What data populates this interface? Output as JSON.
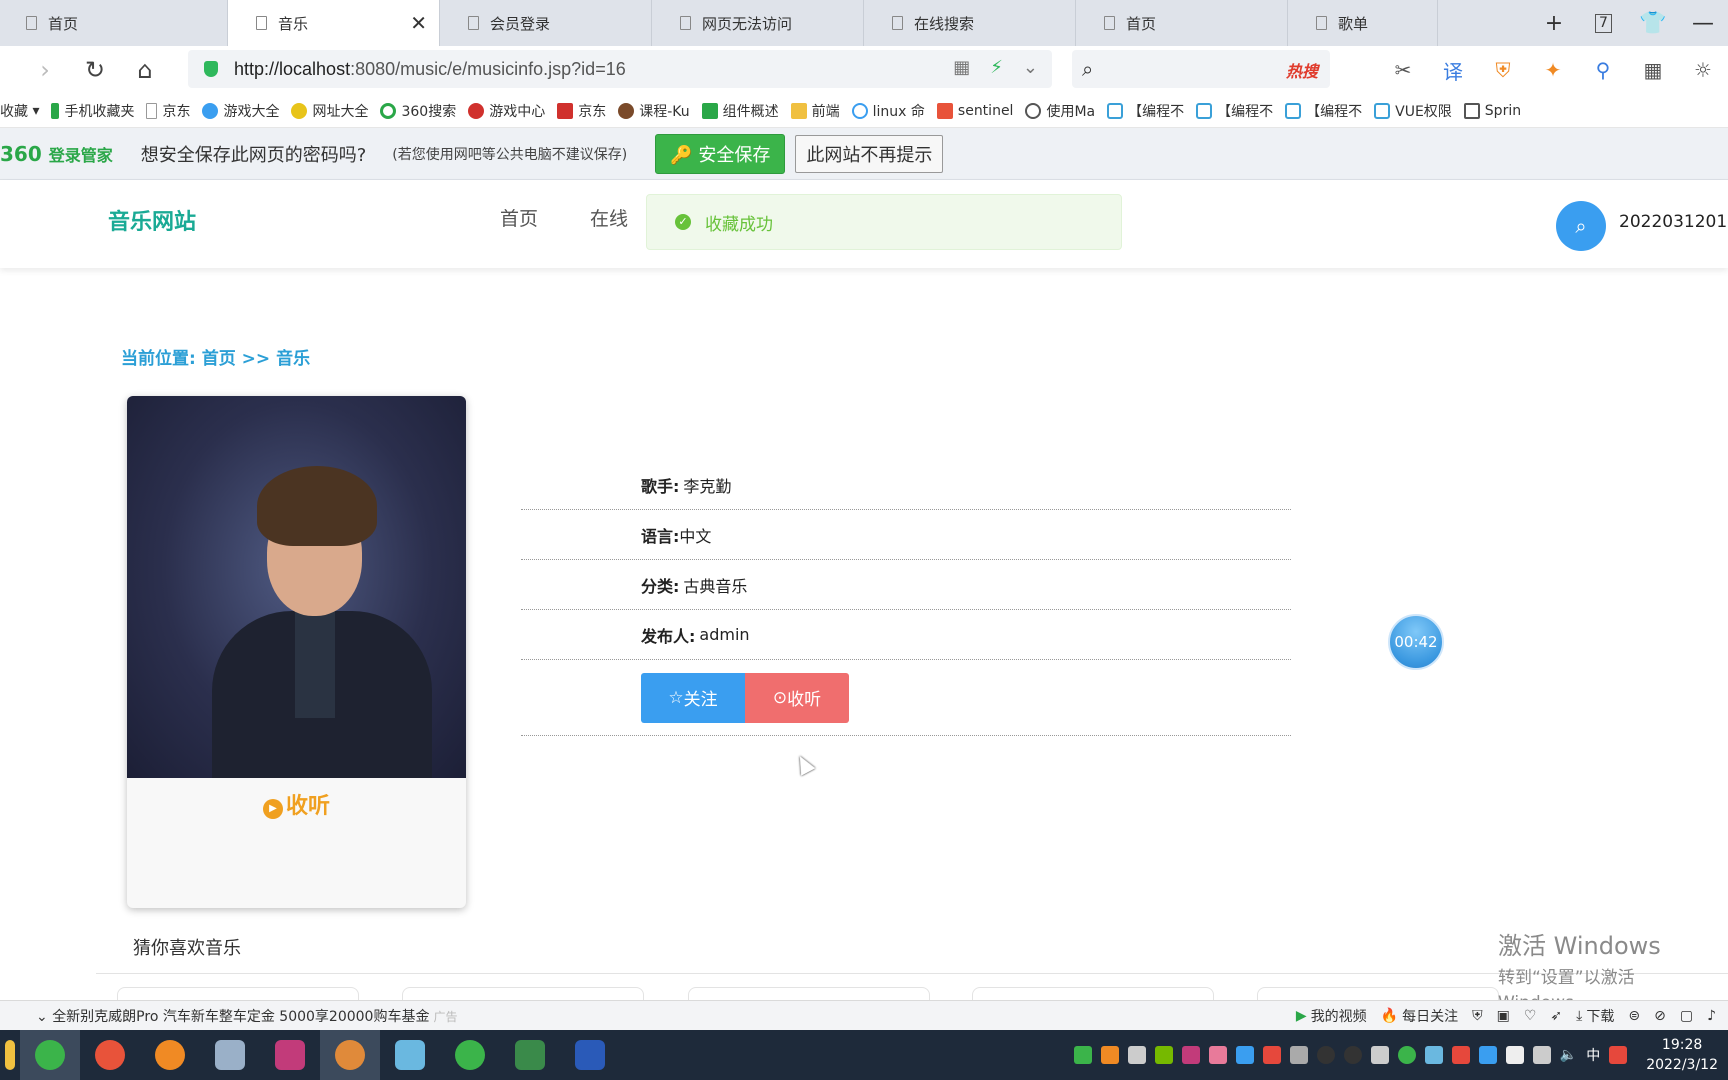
{
  "browser": {
    "tabs": [
      {
        "label": "首页",
        "active": false
      },
      {
        "label": "音乐",
        "active": true
      },
      {
        "label": "会员登录",
        "active": false
      },
      {
        "label": "网页无法访问",
        "active": false
      },
      {
        "label": "在线搜索",
        "active": false
      },
      {
        "label": "首页",
        "active": false
      },
      {
        "label": "歌单",
        "active": false
      }
    ],
    "tab_count": "7",
    "url_host": "http://localhost",
    "url_rest": ":8080/music/e/musicinfo.jsp?id=16",
    "search_hot_label": "热搜",
    "bookmarks": [
      "收藏",
      "手机收藏夹",
      "京东",
      "游戏大全",
      "网址大全",
      "360搜索",
      "游戏中心",
      "京东",
      "课程-Ku",
      "组件概述",
      "前端",
      "linux 命",
      "sentinel",
      "使用Ma",
      "【编程不",
      "【编程不",
      "【编程不",
      "VUE权限",
      "Sprin"
    ]
  },
  "password_bar": {
    "brand_num": "360",
    "brand_text": "登录管家",
    "question": "想安全保存此网页的密码吗?",
    "note": "(若您使用网吧等公共电脑不建议保存)",
    "save_label": "安全保存",
    "dismiss_label": "此网站不再提示"
  },
  "site": {
    "logo": "音乐网站",
    "nav": [
      "首页",
      "在线"
    ],
    "toast": "收藏成功",
    "user_id": "2022031201"
  },
  "breadcrumb": {
    "prefix": "当前位置:",
    "home": "首页",
    "sep": ">>",
    "current": "音乐"
  },
  "card": {
    "listen_label": "收听"
  },
  "info": {
    "singer_label": "歌手:",
    "singer": "李克勤",
    "language_label": "语言:",
    "language": "中文",
    "category_label": "分类:",
    "category": "古典音乐",
    "publisher_label": "发布人:",
    "publisher": "admin",
    "follow_label": "关注",
    "listen_label": "收听"
  },
  "timer": "00:42",
  "guess_title": "猜你喜欢音乐",
  "watermark": {
    "line1": "激活 Windows",
    "line2": "转到“设置”以激活 Windows。"
  },
  "statusbar": {
    "ad": "全新别克威朗Pro 汽车新车整车定金 5000享20000购车基金",
    "ad_tag": "广告",
    "my_video": "我的视频",
    "daily_follow": "每日关注",
    "download": "下载"
  },
  "taskbar": {
    "ime": "中",
    "time": "19:28",
    "date": "2022/3/12"
  },
  "colors": {
    "accent_teal": "#1aaa95",
    "link_blue": "#2b9fd6",
    "follow_blue": "#3a9ef0",
    "listen_red": "#f06e6e",
    "listen_orange": "#f0a020",
    "success_green": "#67c23a"
  }
}
